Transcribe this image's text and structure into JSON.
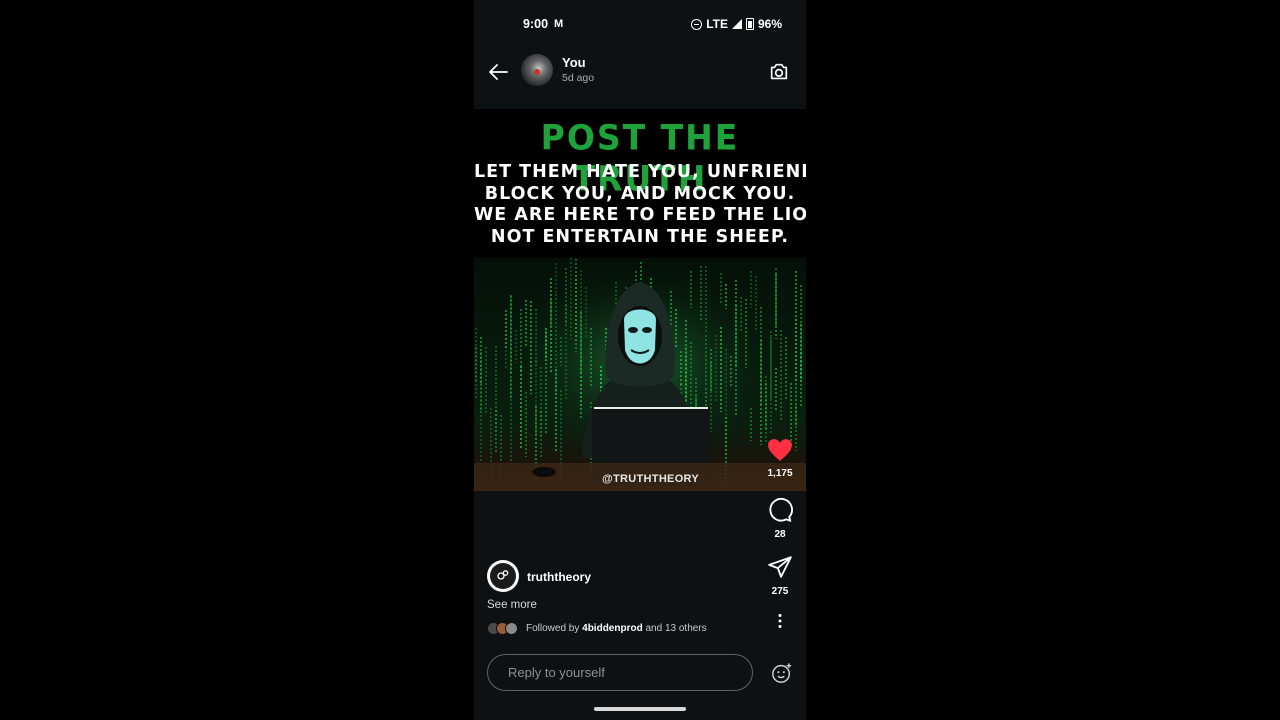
{
  "status_bar": {
    "time": "9:00",
    "network": "LTE",
    "battery": "96%"
  },
  "header": {
    "user_name": "You",
    "time_ago": "5d ago"
  },
  "post": {
    "headline": "POST THE TRUTH",
    "lines": [
      "LET THEM HATE YOU, UNFRIEND YOU.",
      "BLOCK YOU, AND MOCK YOU.",
      "WE ARE HERE TO FEED THE LIONS,",
      "NOT ENTERTAIN THE SHEEP."
    ],
    "watermark": "@TRUTHTHEORY",
    "colors": {
      "headline": "#1ea33b",
      "code_rain": "#22e04a",
      "like": "#ff3040"
    }
  },
  "actions": {
    "likes": "1,175",
    "comments": "28",
    "shares": "275"
  },
  "author": {
    "name": "truththeory",
    "see_more": "See more"
  },
  "followers": {
    "prefix": "Followed by",
    "name": "4biddenprod",
    "suffix": "and 13 others"
  },
  "reply": {
    "placeholder": "Reply to yourself"
  },
  "icons": [
    "back-arrow-icon",
    "camera-icon",
    "heart-icon",
    "comment-icon",
    "share-icon",
    "more-icon",
    "emoji-icon"
  ]
}
